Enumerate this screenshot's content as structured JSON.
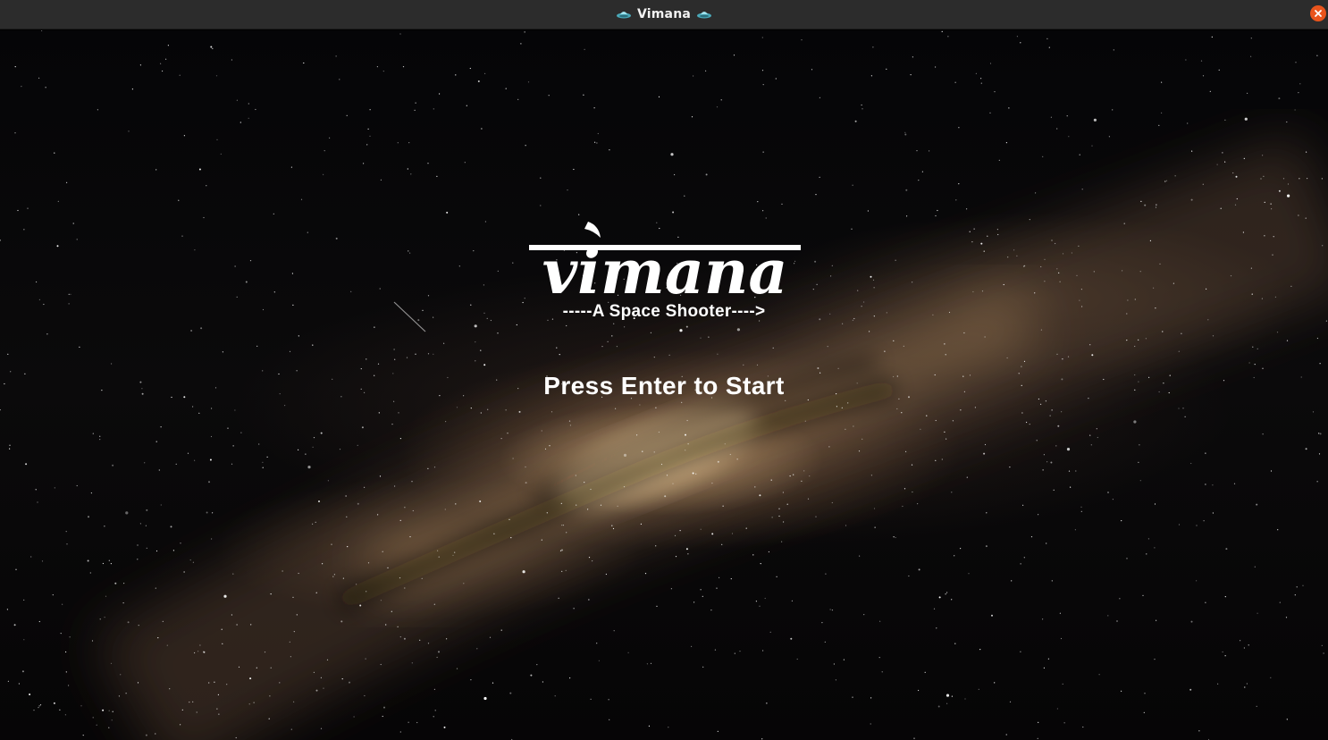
{
  "window": {
    "title": "Vimana",
    "title_icon": "ufo-icon",
    "close_icon": "close-icon",
    "close_color": "#e9541c"
  },
  "game": {
    "logo_text": "vimana",
    "subtitle": "-----A Space Shooter---->",
    "prompt": "Press Enter to Start",
    "background": "milky-way-starfield"
  }
}
